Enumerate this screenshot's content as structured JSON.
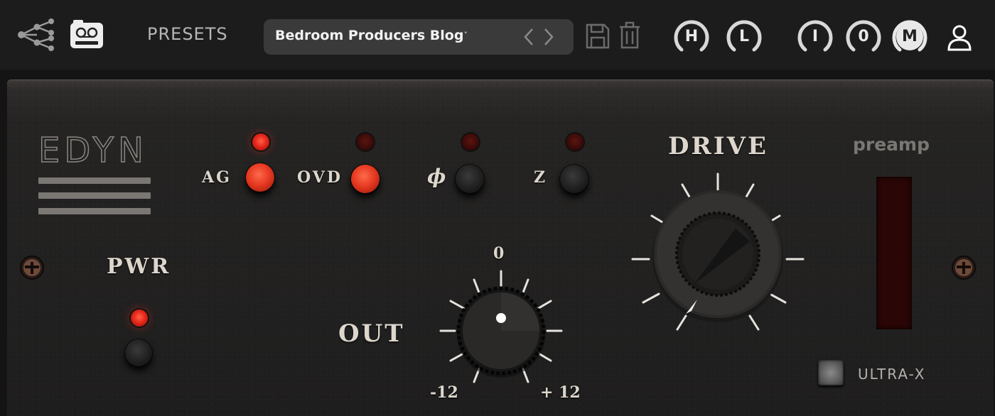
{
  "topbar": {
    "presets_label": "PRESETS",
    "preset_name": "Bedroom Producers Blog",
    "caret": "˅",
    "modes": [
      {
        "label": "H",
        "active": false
      },
      {
        "label": "L",
        "active": false
      },
      {
        "label": "I",
        "active": false
      },
      {
        "label": "0",
        "active": false
      },
      {
        "label": "M",
        "active": true
      }
    ],
    "icons": [
      "network-share-icon",
      "tape-recorder-icon",
      "chevron-left-icon",
      "chevron-right-icon",
      "save-icon",
      "trash-icon",
      "user-icon"
    ]
  },
  "device": {
    "brand": "EDYN",
    "pwr_label": "PWR",
    "pwr_led_on": true,
    "switches": [
      {
        "label": "AG",
        "led_on": true,
        "button_on": true
      },
      {
        "label": "OVD",
        "led_on": false,
        "button_on": true
      },
      {
        "label": "ϕ",
        "led_on": false,
        "button_on": false
      },
      {
        "label": "Z",
        "led_on": false,
        "button_on": false
      }
    ],
    "drive_label": "DRIVE",
    "out_label": "OUT",
    "out_scale": {
      "top": "0",
      "min": "-12",
      "max": "+ 12"
    },
    "preamp_label": "preamp",
    "ultra_label": "ULTRA-X",
    "ultra_on": false
  },
  "colors": {
    "led_red": "#e8281c",
    "panel": "#252423",
    "topbar": "#1c1c1c"
  }
}
